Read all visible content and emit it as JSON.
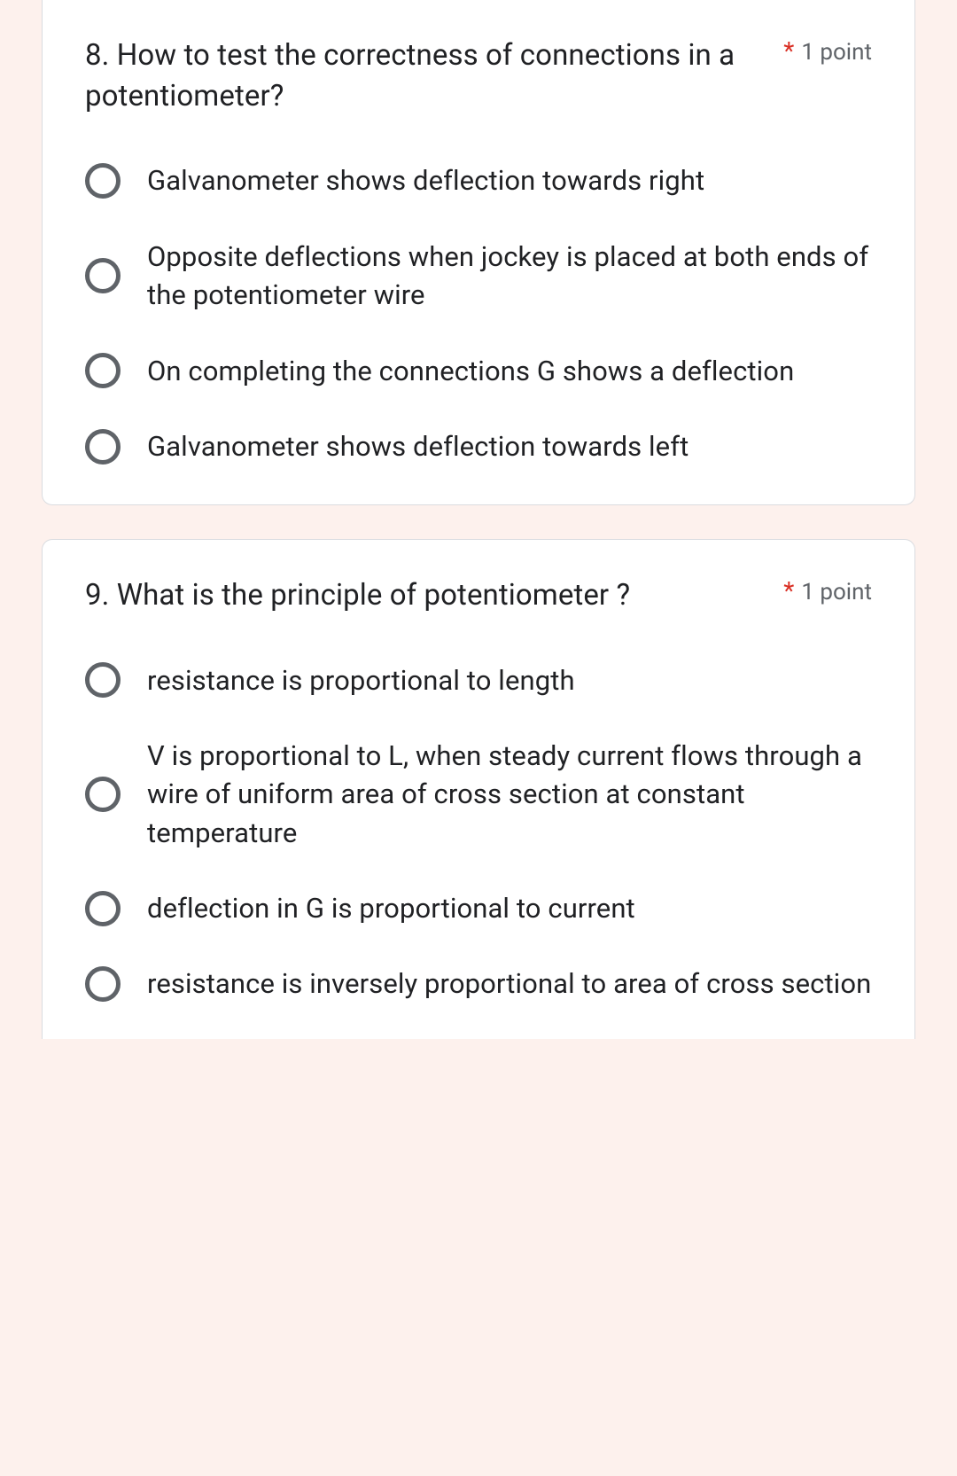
{
  "questions": [
    {
      "title": "8. How to test the correctness of connections in a potentiometer?",
      "points": "1 point",
      "options": [
        "Galvanometer shows deflection towards right",
        "Opposite deflections when jockey is placed at both ends of the potentiometer wire",
        "On completing the connections G shows a deflection",
        "Galvanometer shows deflection towards left"
      ]
    },
    {
      "title": "9. What is the principle of potentiometer ?",
      "points": "1 point",
      "options": [
        "resistance is proportional to length",
        "V is proportional to L, when steady current flows through a wire of uniform area of cross section at constant temperature",
        "deflection in G is proportional to current",
        "resistance is inversely proportional to area of cross section"
      ]
    }
  ]
}
